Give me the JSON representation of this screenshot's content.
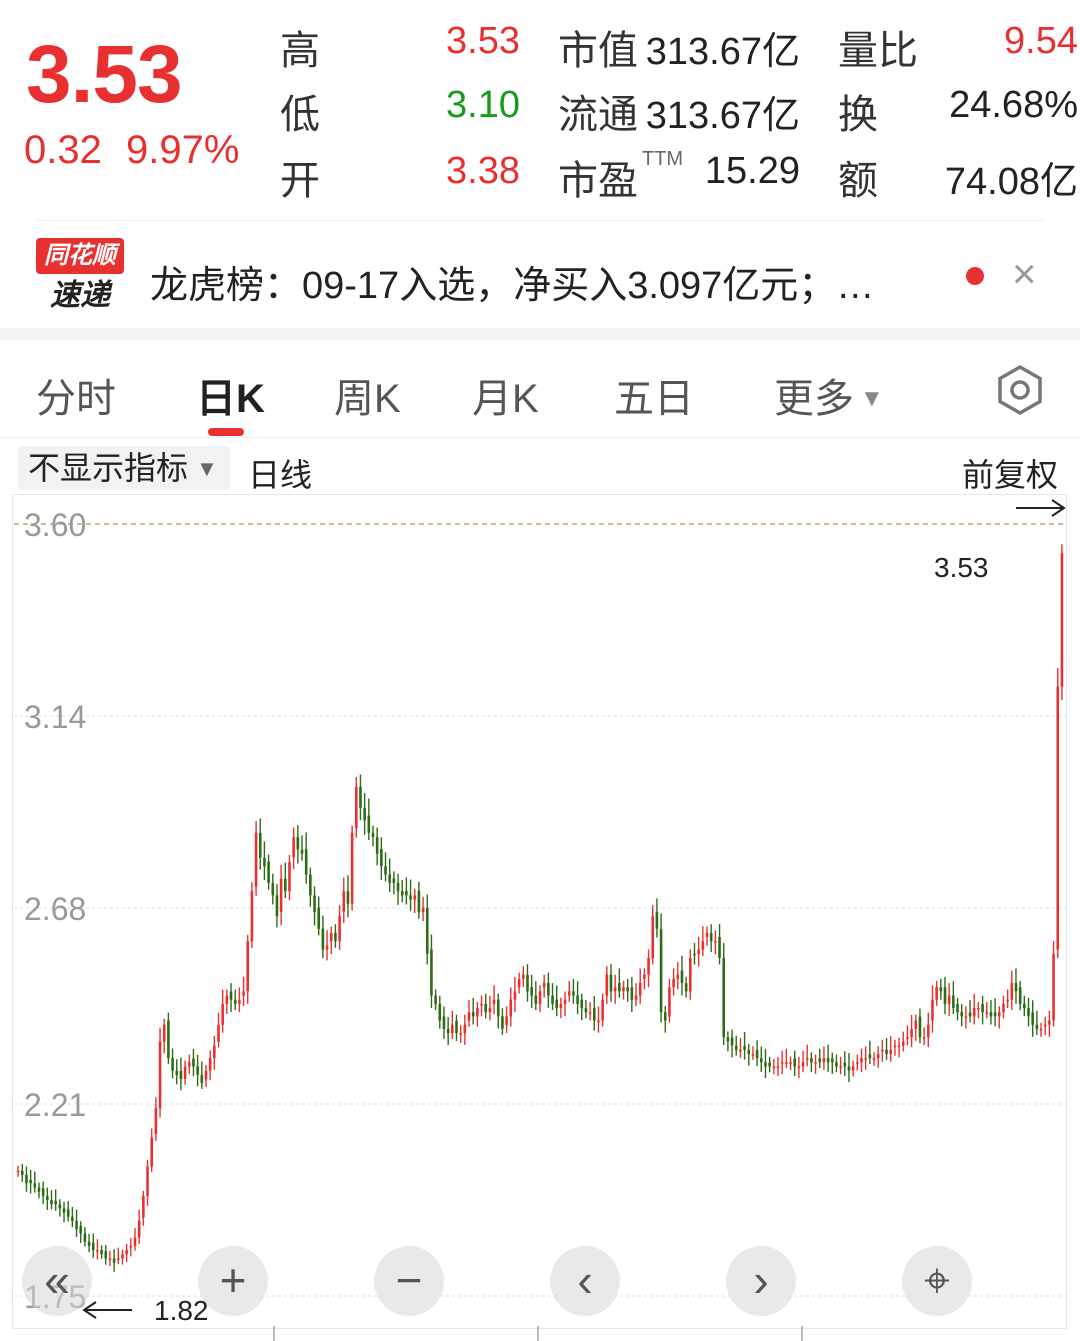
{
  "quote": {
    "price": "3.53",
    "change": "0.32",
    "change_pct": "9.97%",
    "rows": [
      {
        "label1": "高",
        "value1": "3.53",
        "color1": "#e93030",
        "label2": "市值",
        "value2": "313.67亿",
        "label3": "量比",
        "value3": "9.54",
        "color3": "#e93030"
      },
      {
        "label1": "低",
        "value1": "3.10",
        "color1": "#1a9a1a",
        "label2": "流通",
        "value2": "313.67亿",
        "label3": "换",
        "value3": "24.68%",
        "color3": "#222222"
      },
      {
        "label1": "开",
        "value1": "3.38",
        "color1": "#e93030",
        "label2": "市盈",
        "label2_sup": "TTM",
        "value2": "15.29",
        "label3": "额",
        "value3": "74.08亿",
        "color3": "#222222"
      }
    ]
  },
  "news": {
    "logo_top": "同花顺",
    "logo_bottom": "速递",
    "text": "龙虎榜：09-17入选，净买入3.097亿元；…",
    "close_glyph": "×"
  },
  "tabs": [
    {
      "label": "分时",
      "active": false
    },
    {
      "label": "日K",
      "active": true
    },
    {
      "label": "周K",
      "active": false
    },
    {
      "label": "月K",
      "active": false
    },
    {
      "label": "五日",
      "active": false
    },
    {
      "label": "更多",
      "active": false,
      "dropdown": true
    }
  ],
  "toolbar": {
    "indicator": "不显示指标",
    "period_label": "日线",
    "adjust": "前复权"
  },
  "chart_data": {
    "type": "candlestick",
    "y_ticks": [
      "3.60",
      "3.14",
      "2.68",
      "2.21",
      "1.75"
    ],
    "ylim": [
      1.75,
      3.6
    ],
    "max_marker": "3.53",
    "min_marker": "1.82",
    "up_color": "#e93030",
    "down_color": "#2e6b16",
    "close": [
      2.05,
      2.04,
      2.02,
      2.02,
      2.01,
      2.0,
      1.99,
      1.98,
      1.97,
      1.97,
      1.96,
      1.95,
      1.94,
      1.93,
      1.91,
      1.9,
      1.88,
      1.87,
      1.86,
      1.86,
      1.85,
      1.84,
      1.84,
      1.83,
      1.84,
      1.85,
      1.86,
      1.87,
      1.89,
      1.93,
      1.99,
      2.06,
      2.13,
      2.2,
      2.36,
      2.4,
      2.32,
      2.29,
      2.28,
      2.27,
      2.3,
      2.31,
      2.3,
      2.28,
      2.26,
      2.29,
      2.32,
      2.35,
      2.4,
      2.45,
      2.47,
      2.46,
      2.45,
      2.46,
      2.48,
      2.6,
      2.72,
      2.86,
      2.8,
      2.78,
      2.74,
      2.71,
      2.66,
      2.75,
      2.72,
      2.79,
      2.85,
      2.82,
      2.81,
      2.76,
      2.71,
      2.67,
      2.63,
      2.58,
      2.59,
      2.62,
      2.6,
      2.66,
      2.72,
      2.69,
      2.86,
      2.97,
      2.92,
      2.89,
      2.86,
      2.85,
      2.81,
      2.78,
      2.76,
      2.74,
      2.74,
      2.72,
      2.71,
      2.71,
      2.7,
      2.71,
      2.67,
      2.68,
      2.57,
      2.47,
      2.45,
      2.41,
      2.39,
      2.38,
      2.4,
      2.38,
      2.38,
      2.4,
      2.43,
      2.42,
      2.44,
      2.45,
      2.43,
      2.44,
      2.46,
      2.42,
      2.39,
      2.42,
      2.46,
      2.48,
      2.51,
      2.52,
      2.48,
      2.47,
      2.45,
      2.48,
      2.5,
      2.47,
      2.45,
      2.44,
      2.45,
      2.46,
      2.48,
      2.47,
      2.45,
      2.44,
      2.43,
      2.43,
      2.41,
      2.41,
      2.46,
      2.52,
      2.48,
      2.49,
      2.48,
      2.49,
      2.48,
      2.46,
      2.47,
      2.5,
      2.52,
      2.56,
      2.66,
      2.63,
      2.43,
      2.41,
      2.49,
      2.51,
      2.52,
      2.5,
      2.48,
      2.56,
      2.57,
      2.58,
      2.6,
      2.62,
      2.6,
      2.6,
      2.56,
      2.37,
      2.36,
      2.35,
      2.34,
      2.34,
      2.34,
      2.33,
      2.33,
      2.32,
      2.31,
      2.3,
      2.3,
      2.3,
      2.3,
      2.31,
      2.31,
      2.31,
      2.3,
      2.3,
      2.31,
      2.32,
      2.31,
      2.31,
      2.31,
      2.32,
      2.31,
      2.31,
      2.3,
      2.3,
      2.3,
      2.29,
      2.3,
      2.31,
      2.32,
      2.32,
      2.32,
      2.32,
      2.33,
      2.34,
      2.33,
      2.34,
      2.35,
      2.35,
      2.36,
      2.37,
      2.39,
      2.41,
      2.37,
      2.37,
      2.4,
      2.46,
      2.49,
      2.48,
      2.45,
      2.47,
      2.44,
      2.43,
      2.42,
      2.42,
      2.42,
      2.44,
      2.44,
      2.43,
      2.43,
      2.42,
      2.42,
      2.43,
      2.45,
      2.46,
      2.5,
      2.48,
      2.45,
      2.44,
      2.42,
      2.4,
      2.39,
      2.39,
      2.4,
      2.41,
      2.57,
      3.21,
      3.53
    ]
  },
  "controls": [
    {
      "name": "scroll-start-button",
      "glyph": "«"
    },
    {
      "name": "zoom-in-button",
      "glyph": "+"
    },
    {
      "name": "zoom-out-button",
      "glyph": "−"
    },
    {
      "name": "scroll-left-button",
      "glyph": "‹"
    },
    {
      "name": "scroll-right-button",
      "glyph": "›"
    },
    {
      "name": "crosshair-button",
      "glyph": "⌖"
    }
  ]
}
